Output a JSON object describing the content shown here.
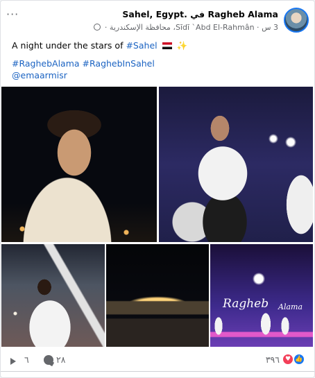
{
  "post": {
    "author": "Ragheb Alama",
    "location_prefix": "في",
    "location": "Sahel, Egypt.",
    "time": "3 س",
    "place": "Sīdī `Abd El-Rahmân، محافظة الإسكندرية",
    "more": "···"
  },
  "body": {
    "line1_prefix": "A night under the stars of ",
    "line1_tag": "#Sahel",
    "hashtag1": "#RaghebAlama",
    "hashtag2": "#RaghebInSahel",
    "mention": "@emaarmisr"
  },
  "photos": {
    "signature_main": "Ragheb",
    "signature_second": "Alama"
  },
  "footer": {
    "shares": "٦",
    "comments": "٢٨",
    "reactions": "٣٩٦"
  },
  "icons": {
    "share": "share-icon",
    "comment": "comment-icon",
    "like": "like-icon",
    "love": "love-icon",
    "globe": "globe-icon",
    "flag": "egypt-flag-icon",
    "sparkle": "sparkles-icon"
  },
  "colors": {
    "link": "#1b63c2",
    "like": "#1877f2",
    "love": "#f33e58",
    "muted": "#65676b"
  }
}
